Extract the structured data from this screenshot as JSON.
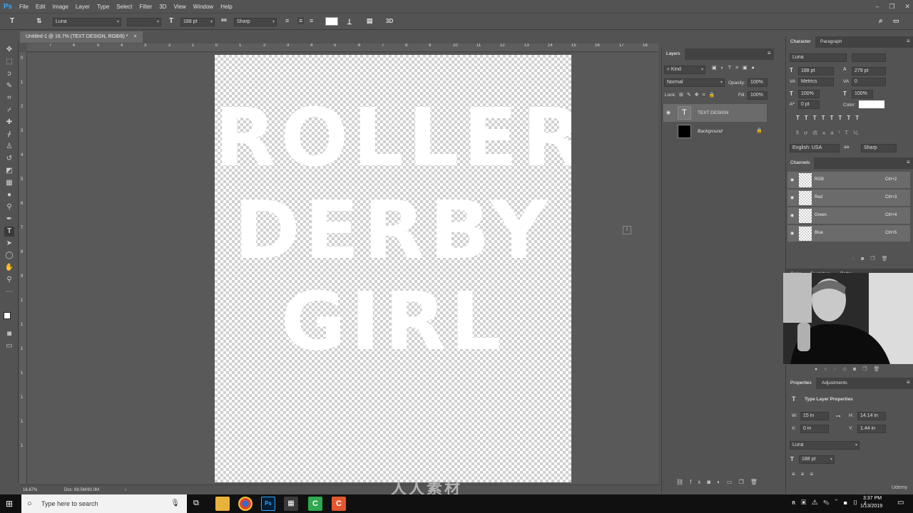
{
  "app": {
    "logo": "Ps"
  },
  "menu": [
    "File",
    "Edit",
    "Image",
    "Layer",
    "Type",
    "Select",
    "Filter",
    "3D",
    "View",
    "Window",
    "Help"
  ],
  "options": {
    "font_family": "Luna",
    "font_size": "188 pt",
    "antialias": "Sharp",
    "mode_3d": "3D"
  },
  "document": {
    "tab_title": "Untitled-1 @ 16.7% (TEXT DESIGN, RGB/8) *",
    "close": "×"
  },
  "ruler_top": [
    "7",
    "6",
    "5",
    "4",
    "3",
    "2",
    "1",
    "0",
    "1",
    "2",
    "3",
    "4",
    "5",
    "6",
    "7",
    "8",
    "9",
    "10",
    "11",
    "12",
    "13",
    "14",
    "15",
    "16",
    "17",
    "18"
  ],
  "ruler_left": [
    "0",
    "1",
    "2",
    "3",
    "4",
    "5",
    "6",
    "7",
    "8",
    "9",
    "1",
    "1",
    "1",
    "1",
    "1",
    "1",
    "1"
  ],
  "canvas_text": [
    "ROLLER",
    "DERBY",
    "GIRL"
  ],
  "status": {
    "zoom": "16.67%",
    "doc": "Doc: 69.5M/60.0M"
  },
  "layers_panel": {
    "tab": "Layers",
    "filter_kind": "Kind",
    "blend_mode": "Normal",
    "opacity_label": "Opacity:",
    "opacity": "100%",
    "lock_label": "Lock:",
    "fill_label": "Fill:",
    "fill": "100%",
    "layers": [
      {
        "name": "TEXT DESIGN",
        "type": "text"
      },
      {
        "name": "Background",
        "type": "fill"
      }
    ]
  },
  "character": {
    "tabs": [
      "Character",
      "Paragraph"
    ],
    "font": "Luna",
    "size": "188 pt",
    "leading": "279 pt",
    "kerning": "Metrics",
    "tracking": "0",
    "vscale": "100%",
    "hscale": "100%",
    "baseline": "0 pt",
    "color_label": "Color:",
    "color": "#ffffff",
    "language": "English: USA",
    "aa": "Sharp"
  },
  "channels": {
    "tab": "Channels",
    "rows": [
      {
        "name": "RGB",
        "shortcut": "Ctrl+2"
      },
      {
        "name": "Red",
        "shortcut": "Ctrl+3"
      },
      {
        "name": "Green",
        "shortcut": "Ctrl+4"
      },
      {
        "name": "Blue",
        "shortcut": "Ctrl+5"
      }
    ]
  },
  "hidden_tabs": [
    "Color",
    "Swatches",
    "Paths"
  ],
  "properties": {
    "tabs": [
      "Properties",
      "Adjustments"
    ],
    "title": "Type Layer Properties",
    "w_label": "W:",
    "w": "15 in",
    "h_label": "H:",
    "h": "14.14 in",
    "x_label": "X:",
    "x": "0 in",
    "y_label": "Y:",
    "y": "1.44 in",
    "font": "Luna",
    "size": "188 pt"
  },
  "taskbar": {
    "search": "Type here to search",
    "time": "3:37 PM",
    "date": "1/13/2019"
  },
  "watermark": "人人素材",
  "udemy": "Udemy"
}
